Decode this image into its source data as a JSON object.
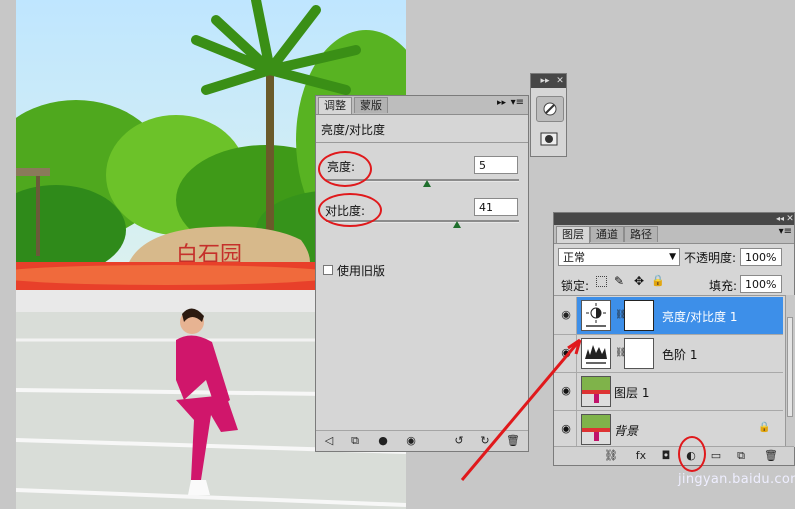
{
  "adjust_panel": {
    "tabs": [
      "调整",
      "蒙版"
    ],
    "title": "亮度/对比度",
    "brightness_label": "亮度:",
    "brightness_value": "5",
    "brightness_level": 0.525,
    "contrast_label": "对比度:",
    "contrast_value": "41",
    "contrast_level": 0.68,
    "legacy_label": "使用旧版"
  },
  "tool_panel": {},
  "layers_panel": {
    "tabs": [
      "图层",
      "通道",
      "路径"
    ],
    "blend_mode": "正常",
    "opacity_label": "不透明度:",
    "opacity_value": "100%",
    "lock_label": "锁定:",
    "fill_label": "填充:",
    "fill_value": "100%",
    "layers": [
      {
        "name": "亮度/对比度 1",
        "selected": true
      },
      {
        "name": "色阶 1",
        "selected": false
      },
      {
        "name": "图层 1",
        "selected": false
      },
      {
        "name": "背景",
        "selected": false
      }
    ]
  },
  "photo": {
    "sign_text": "白石园"
  },
  "watermark": "jingyan.baidu.com",
  "colors": {
    "selection": "#3d8fe9",
    "annotation": "#e0191c",
    "panel_bg": "#d6d6d6",
    "canvas_bg": "#c7c7c7"
  }
}
